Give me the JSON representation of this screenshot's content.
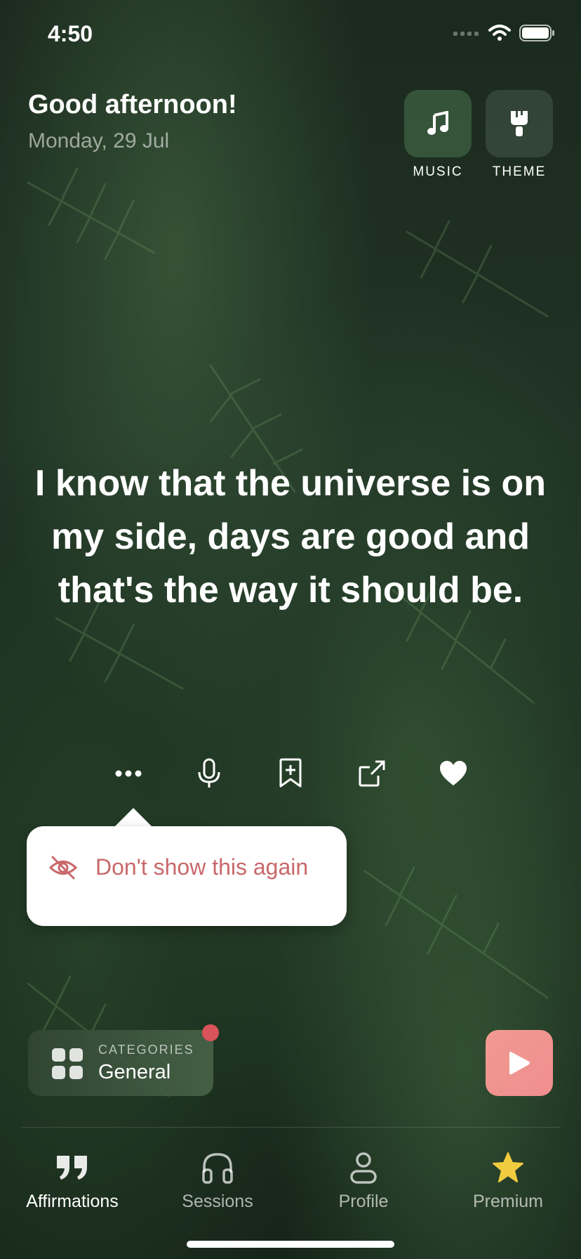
{
  "status_bar": {
    "time": "4:50"
  },
  "header": {
    "greeting": "Good afternoon!",
    "date": "Monday, 29 Jul",
    "music_label": "MUSIC",
    "theme_label": "THEME"
  },
  "affirmation": {
    "text": "I know that the universe is on my side, days are good and that's the way it should be."
  },
  "actions": [
    "more-icon",
    "microphone-icon",
    "bookmark-add-icon",
    "share-icon",
    "heart-icon"
  ],
  "popover": {
    "item_label": "Don't show this again",
    "color": "#c9686a"
  },
  "categories": {
    "label": "CATEGORIES",
    "value": "General",
    "badge_color": "#d9545a"
  },
  "play": {
    "color": "#f19a92"
  },
  "tabs": [
    {
      "label": "Affirmations",
      "icon": "quote-icon",
      "active": true
    },
    {
      "label": "Sessions",
      "icon": "headphones-icon",
      "active": false
    },
    {
      "label": "Profile",
      "icon": "person-icon",
      "active": false
    },
    {
      "label": "Premium",
      "icon": "star-icon",
      "active": false,
      "icon_color": "#f2cc3f"
    }
  ]
}
